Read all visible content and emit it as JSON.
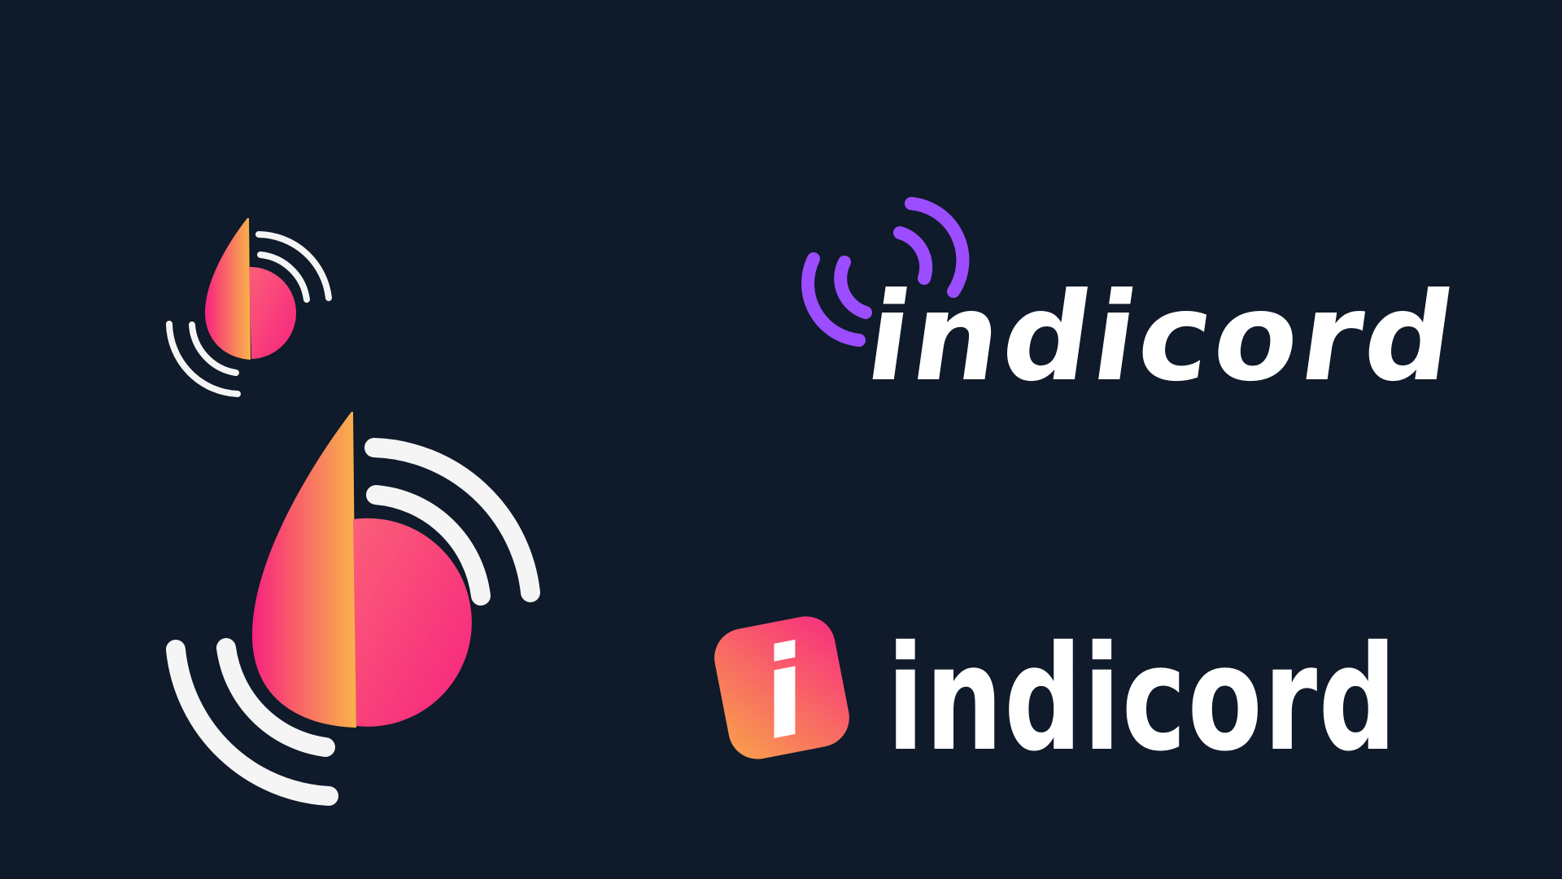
{
  "canvas": {
    "background_color": "#0f1a2a"
  },
  "colors": {
    "arc_white": "#f5f5f5",
    "arc_purple": "#9b4dff",
    "drop_orange": "#f9b44a",
    "drop_pink": "#f7237e",
    "badge_orange": "#f9a24a",
    "badge_pink": "#f72d80",
    "wordmark_white": "#ffffff"
  },
  "marks": [
    {
      "name": "small-drop-signal-logo",
      "icon": "drop-with-signal-arcs-icon"
    },
    {
      "name": "large-drop-signal-logo",
      "icon": "drop-with-signal-arcs-icon"
    },
    {
      "name": "broadcast-wordmark-logo",
      "icon": "broadcast-signal-icon"
    },
    {
      "name": "badge-wordmark-logo",
      "icon": "rounded-square-badge-icon"
    }
  ],
  "wordmarks": {
    "top_text": "indicord",
    "bottom_text": "indicord",
    "badge_letter": "i"
  }
}
